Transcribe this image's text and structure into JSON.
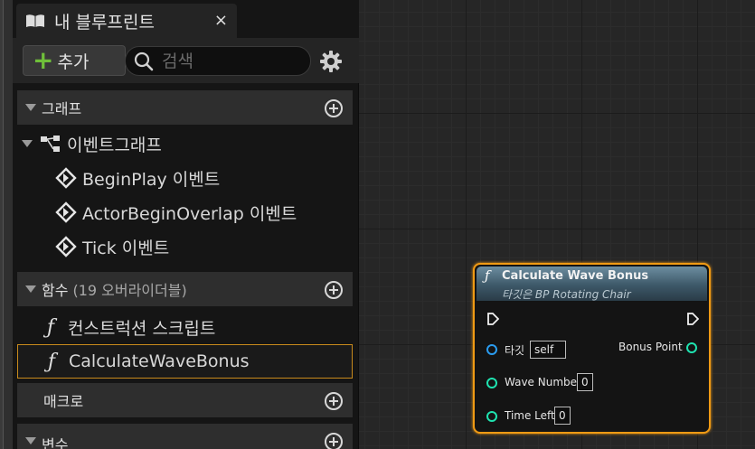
{
  "panel": {
    "tab_title": "내 블루프린트",
    "close_glyph": "×",
    "add_label": "추가",
    "search_placeholder": "검색"
  },
  "sections": {
    "graph": {
      "label": "그래프"
    },
    "functions": {
      "label": "함수",
      "count": "(19 오버라이더블)"
    },
    "macros": {
      "label": "매크로"
    },
    "variables": {
      "label": "변수"
    }
  },
  "tree": {
    "event_graph": "이벤트그래프",
    "events": [
      "BeginPlay 이벤트",
      "ActorBeginOverlap 이벤트",
      "Tick 이벤트"
    ],
    "construction_script": "컨스트럭션 스크립트",
    "calculate_wave_bonus": "CalculateWaveBonus"
  },
  "node": {
    "title": "Calculate Wave Bonus",
    "subtitle": "타깃은 BP Rotating Chair",
    "inputs": [
      {
        "label": "타깃",
        "value": "self",
        "color": "#2a9cf0"
      },
      {
        "label": "Wave Number",
        "value": "0",
        "color": "#1fe3b0"
      },
      {
        "label": "Time Left",
        "value": "0",
        "color": "#1fe3b0"
      }
    ],
    "output": {
      "label": "Bonus Point",
      "color": "#1fe3b0"
    }
  },
  "colors": {
    "accent_orange": "#f09a14",
    "add_green": "#6fbf3a"
  },
  "icons": {
    "tab": "book-icon",
    "search": "search-icon",
    "settings": "gear-icon",
    "event": "event-diamond-icon",
    "function": "function-icon"
  }
}
